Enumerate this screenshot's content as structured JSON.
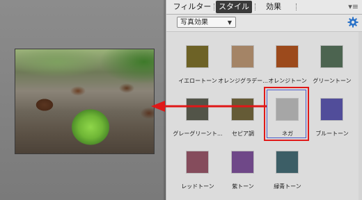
{
  "tabs": {
    "filters": "フィルター",
    "styles": "スタイル",
    "effects": "効果"
  },
  "dropdown": {
    "value": "写真効果"
  },
  "styles": [
    {
      "label": "イエロートーン",
      "color": "#6d6226"
    },
    {
      "label": "オレンジグラデー...",
      "color": "#a48466"
    },
    {
      "label": "オレンジトーン",
      "color": "#9c4a1c"
    },
    {
      "label": "グリーントーン",
      "color": "#4c6450"
    },
    {
      "label": "グレーグリーント...",
      "color": "#525448"
    },
    {
      "label": "セピア調",
      "color": "#655b36"
    },
    {
      "label": "ネガ",
      "color": "#a6a6a6"
    },
    {
      "label": "ブルートーン",
      "color": "#514d9a"
    },
    {
      "label": "レッドトーン",
      "color": "#854c5c"
    },
    {
      "label": "紫トーン",
      "color": "#6f4888"
    },
    {
      "label": "緑青トーン",
      "color": "#3c5e66"
    }
  ],
  "colors": {
    "highlight": "#e01818",
    "arrow": "#e01818",
    "gear": "#2a72c8"
  },
  "icons": {
    "panel_menu": "panel-menu-icon",
    "gear": "gear-icon",
    "caret": "chevron-down-icon"
  }
}
